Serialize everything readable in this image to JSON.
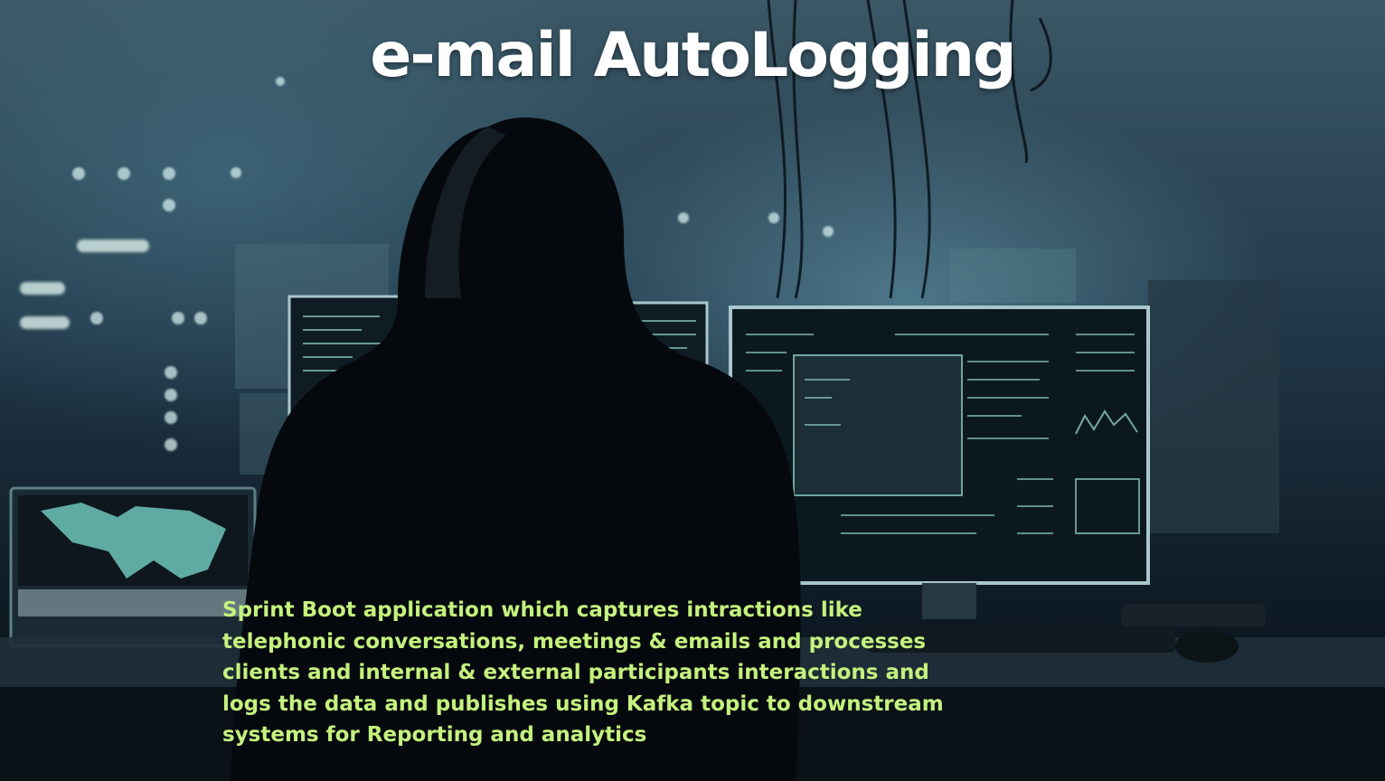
{
  "slide": {
    "title": "e-mail AutoLogging",
    "description": "Sprint Boot application which captures intractions like telephonic conversations, meetings & emails and processes clients and internal & external participants interactions and logs the data and publishes using Kafka topic to downstream systems for Reporting and analytics"
  },
  "colors": {
    "title_text": "#ffffff",
    "description_text": "#c4f27e",
    "screen_glow": "#8fd0c4"
  },
  "background": {
    "image_icon": "hooded-hacker-at-computers-image"
  }
}
